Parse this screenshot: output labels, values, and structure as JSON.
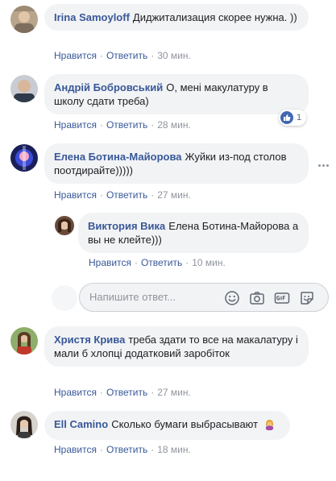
{
  "comments": [
    {
      "author": "Irina Samoyloff",
      "text": "Диджитализация скорее нужна. ))",
      "like_label": "Нравится",
      "reply_label": "Ответить",
      "time": "30 мин."
    },
    {
      "author": "Андрій Бобровський",
      "text": "О, мені макулатуру в школу сдати треба)",
      "like_label": "Нравится",
      "reply_label": "Ответить",
      "time": "28 мин.",
      "reaction_count": "1"
    },
    {
      "author": "Елена Ботина-Майорова",
      "text": "Жуйки из-под столов поотдирайте)))))",
      "like_label": "Нравится",
      "reply_label": "Ответить",
      "time": "27 мин."
    },
    {
      "author": "Виктория Вика",
      "text": "Елена Ботина-Майорова а вы не клейте)))",
      "like_label": "Нравится",
      "reply_label": "Ответить",
      "time": "10 мин."
    },
    {
      "author": "Христя Крива",
      "text": "треба здати то все на макалатуру і мали б хлопці додатковий заробіток",
      "like_label": "Нравится",
      "reply_label": "Ответить",
      "time": "27 мин."
    },
    {
      "author": "Ell Camino",
      "text": "Сколько бумаги выбрасывают",
      "like_label": "Нравится",
      "reply_label": "Ответить",
      "time": "18 мин."
    }
  ],
  "reply_box": {
    "placeholder": "Напишите ответ..."
  },
  "colors": {
    "link": "#385898",
    "bubble": "#f2f3f5",
    "meta": "#90949c",
    "like_blue": "#4267b2"
  }
}
